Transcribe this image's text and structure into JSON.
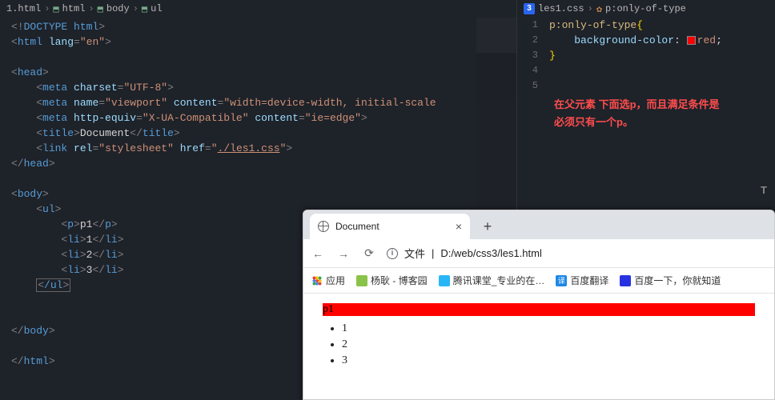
{
  "left": {
    "breadcrumb": [
      "1.html",
      "html",
      "body",
      "ul"
    ],
    "code": {
      "l1a": "<!",
      "l1b": "DOCTYPE",
      "l1c": " html",
      "l1d": ">",
      "l2a": "<",
      "l2b": "html",
      "l2c": " lang",
      "l2d": "=",
      "l2e": "\"en\"",
      "l2f": ">",
      "l3a": "<",
      "l3b": "head",
      "l3c": ">",
      "l4a": "<",
      "l4b": "meta",
      "l4c": " charset",
      "l4d": "=",
      "l4e": "\"UTF-8\"",
      "l4f": ">",
      "l5a": "<",
      "l5b": "meta",
      "l5c": " name",
      "l5d": "=",
      "l5e": "\"viewport\"",
      "l5f": " content",
      "l5g": "=",
      "l5h": "\"width=device-width, initial-scale",
      "l6a": "<",
      "l6b": "meta",
      "l6c": " http-equiv",
      "l6d": "=",
      "l6e": "\"X-UA-Compatible\"",
      "l6f": " content",
      "l6g": "=",
      "l6h": "\"ie=edge\"",
      "l6i": ">",
      "l7a": "<",
      "l7b": "title",
      "l7c": ">",
      "l7d": "Document",
      "l7e": "</",
      "l7f": "title",
      "l7g": ">",
      "l8a": "<",
      "l8b": "link",
      "l8c": " rel",
      "l8d": "=",
      "l8e": "\"stylesheet\"",
      "l8f": " href",
      "l8g": "=",
      "l8h": "\"",
      "l8i": "./les1.css",
      "l8j": "\"",
      "l8k": ">",
      "l9a": "</",
      "l9b": "head",
      "l9c": ">",
      "l10a": "<",
      "l10b": "body",
      "l10c": ">",
      "l11a": "<",
      "l11b": "ul",
      "l11c": ">",
      "l12a": "<",
      "l12b": "p",
      "l12c": ">",
      "l12d": "p1",
      "l12e": "</",
      "l12f": "p",
      "l12g": ">",
      "l13a": "<",
      "l13b": "li",
      "l13c": ">",
      "l13d": "1",
      "l13e": "</",
      "l13f": "li",
      "l13g": ">",
      "l14a": "<",
      "l14b": "li",
      "l14c": ">",
      "l14d": "2",
      "l14e": "</",
      "l14f": "li",
      "l14g": ">",
      "l15a": "<",
      "l15b": "li",
      "l15c": ">",
      "l15d": "3",
      "l15e": "</",
      "l15f": "li",
      "l15g": ">",
      "l16a": "<",
      "l16b": "/ul",
      "l16c": ">",
      "l17a": "</",
      "l17b": "body",
      "l17c": ">",
      "l18a": "</",
      "l18b": "html",
      "l18c": ">"
    }
  },
  "right": {
    "breadcrumb_file": "les1.css",
    "breadcrumb_sel": "p:only-of-type",
    "lines": [
      "1",
      "2",
      "3",
      "4",
      "5"
    ],
    "code": {
      "l1a": "p:only-of-type",
      "l1b": "{",
      "l2a": "background-color",
      "l2b": ": ",
      "l2c": "red",
      "l2d": ";",
      "l3a": "}"
    },
    "note_l1": "在父元素 下面选p，而且满足条件是",
    "note_l2": "必须只有一个p。"
  },
  "browser": {
    "tab_title": "Document",
    "addr_label": "文件",
    "addr_path": "D:/web/css3/les1.html",
    "bookmarks": {
      "apps": "应用",
      "b1": "杨耿 - 博客园",
      "b2": "腾讯课堂_专业的在…",
      "b3": "百度翻译",
      "b4": "百度一下，你就知道"
    },
    "content": {
      "p": "p1",
      "li1": "1",
      "li2": "2",
      "li3": "3"
    }
  }
}
